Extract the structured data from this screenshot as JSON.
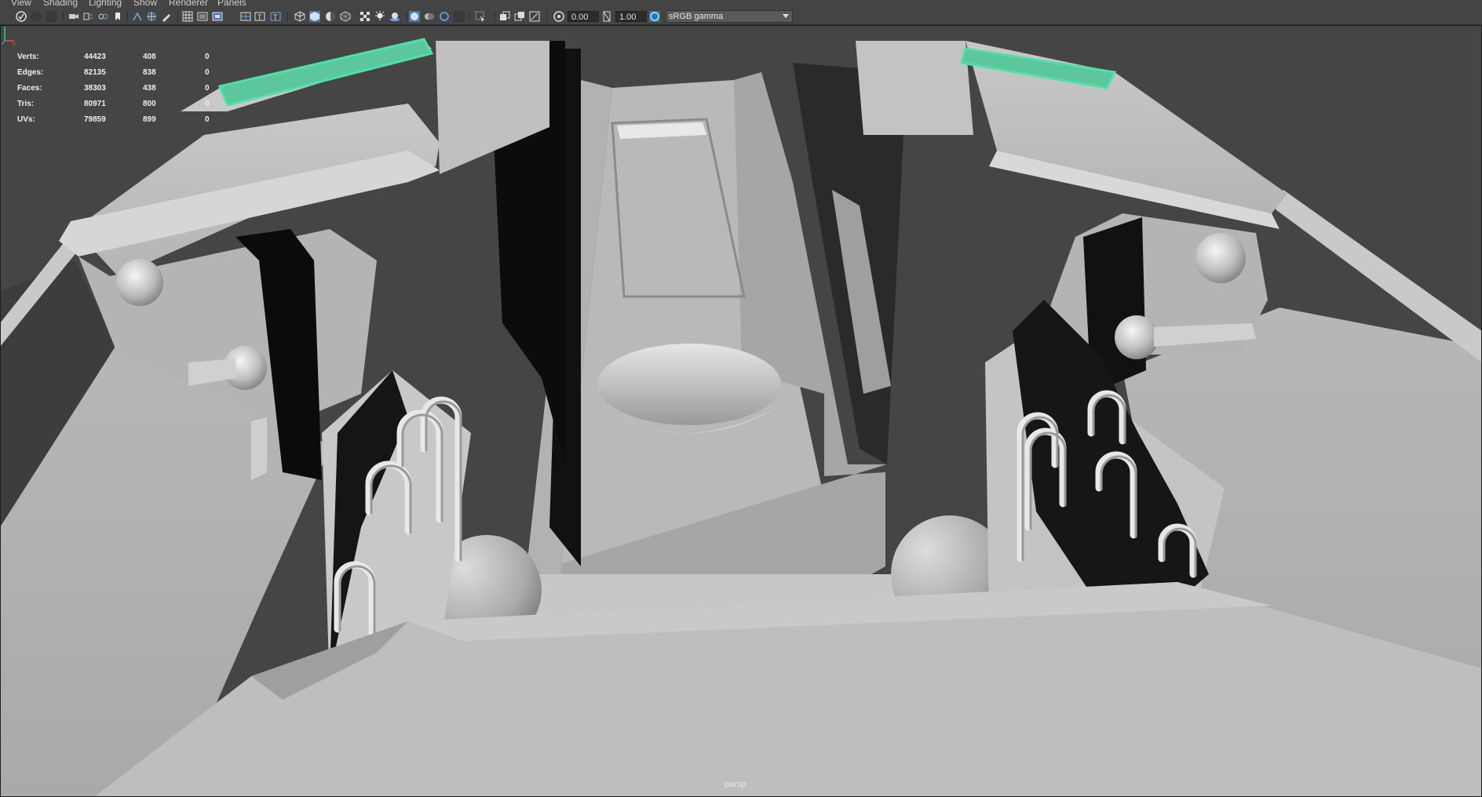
{
  "menubar": {
    "items": [
      "View",
      "Shading",
      "Lighting",
      "Show",
      "Renderer",
      "Panels"
    ]
  },
  "toolbar": {
    "icons": [
      "select-camera-icon",
      "camera-attributes-icon",
      "bookmark-icon",
      "image-plane-icon",
      "grid-icon",
      "film-gate-icon",
      "resolution-gate-icon",
      "wireframe-icon",
      "smooth-shade-icon",
      "textured-icon",
      "lights-icon",
      "shadows-icon",
      "isolate-icon",
      "xray-icon",
      "gamma-icon"
    ],
    "exposure_value": "0.00",
    "gamma_value": "1.00",
    "color_space": "sRGB gamma"
  },
  "hud": {
    "rows": [
      {
        "label": "Verts:",
        "v1": "44423",
        "v2": "408",
        "v3": "0"
      },
      {
        "label": "Edges:",
        "v1": "82135",
        "v2": "838",
        "v3": "0"
      },
      {
        "label": "Faces:",
        "v1": "38303",
        "v2": "438",
        "v3": "0"
      },
      {
        "label": "Tris:",
        "v1": "80971",
        "v2": "800",
        "v3": "0"
      },
      {
        "label": "UVs:",
        "v1": "79859",
        "v2": "899",
        "v3": "0"
      }
    ]
  },
  "viewport": {
    "camera": "persp",
    "selection_color": "#4fe0a8"
  }
}
